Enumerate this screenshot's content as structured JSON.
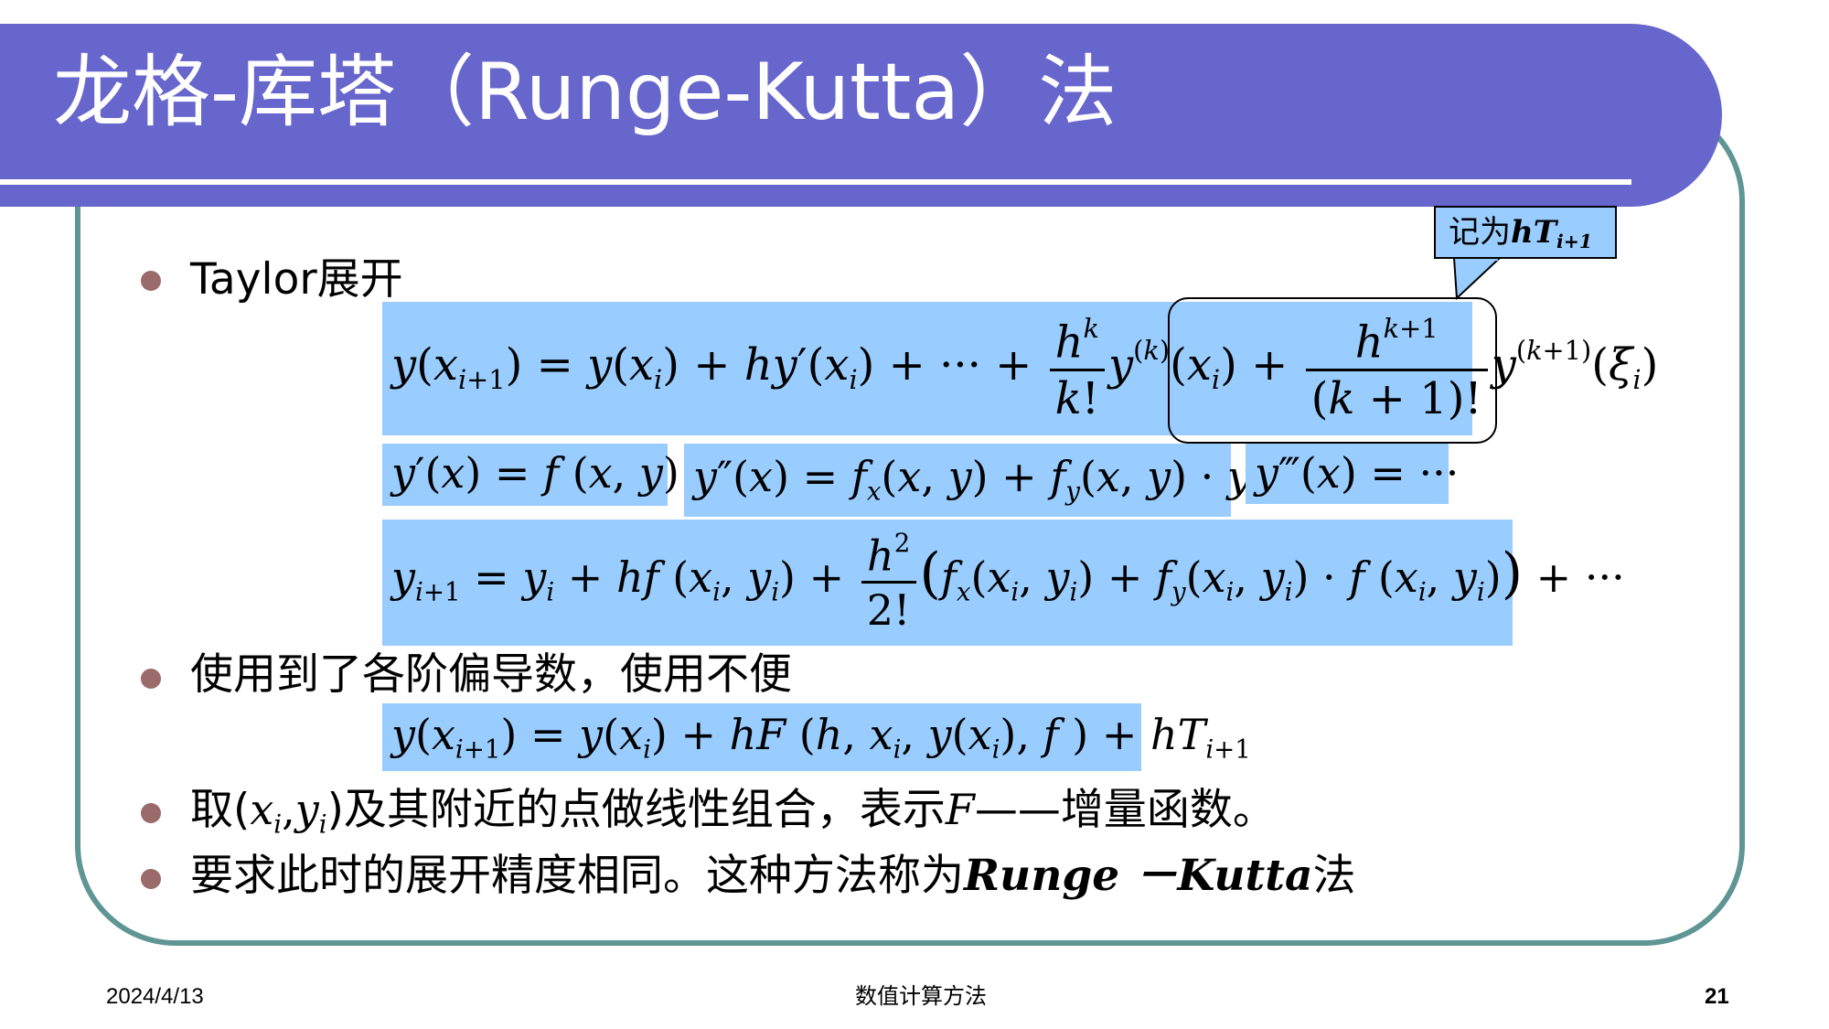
{
  "title": "龙格-库塔（Runge-Kutta）法",
  "bullets": {
    "b1": "Taylor展开",
    "b2": "使用到了各阶偏导数，使用不便",
    "b3_pre": "取(",
    "b3_mid": ")及其附近的点做线性组合，表示",
    "b3_F": "F",
    "b3_post": "——增量函数。",
    "b4_pre": "要求此时的展开精度相同。这种方法称为",
    "b4_rk": "Runge －Kutta",
    "b4_post": "法"
  },
  "callout": {
    "prefix": "记为",
    "hT": "hT",
    "sub": "i+1"
  },
  "footer": {
    "date": "2024/4/13",
    "center": "数值计算方法",
    "page": "21"
  }
}
